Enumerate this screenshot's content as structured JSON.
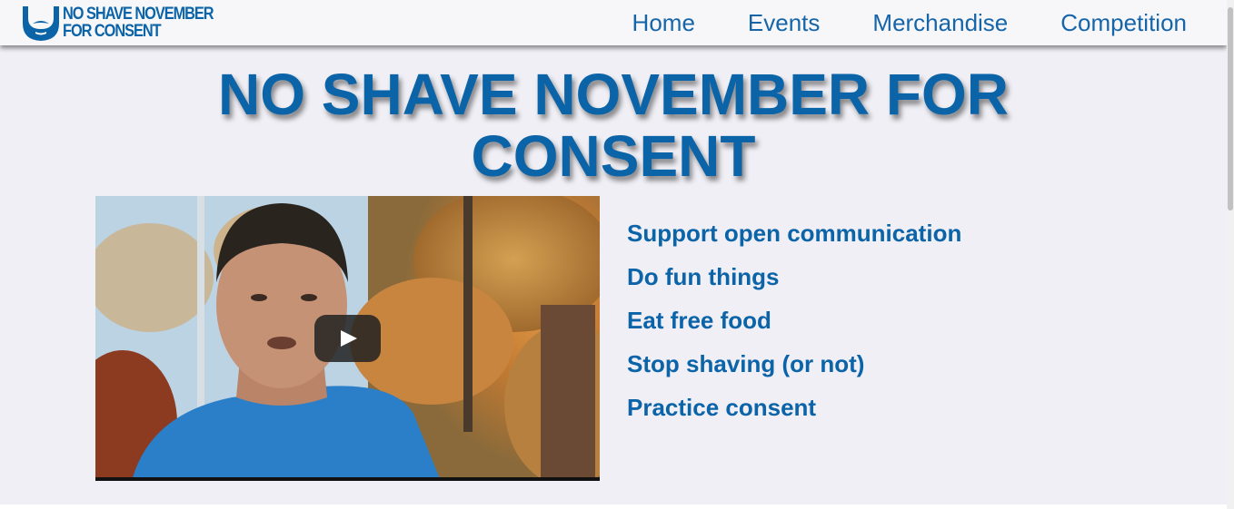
{
  "header": {
    "logo_line1": "NO SHAVE NOVEMBER",
    "logo_line2": "FOR CONSENT",
    "nav": [
      {
        "label": "Home"
      },
      {
        "label": "Events"
      },
      {
        "label": "Merchandise"
      },
      {
        "label": "Competition"
      }
    ]
  },
  "hero": {
    "title": "NO SHAVE NOVEMBER FOR CONSENT"
  },
  "features": [
    "Support open communication",
    "Do fun things",
    "Eat free food",
    "Stop shaving (or not)",
    "Practice consent"
  ],
  "icons": {
    "logo": "beard-icon",
    "video_play": "play-icon"
  },
  "colors": {
    "brand_blue": "#0b63a8",
    "nav_blue": "#1565a8",
    "page_bg": "#efeff5",
    "navbar_bg": "#f7f7f9"
  }
}
